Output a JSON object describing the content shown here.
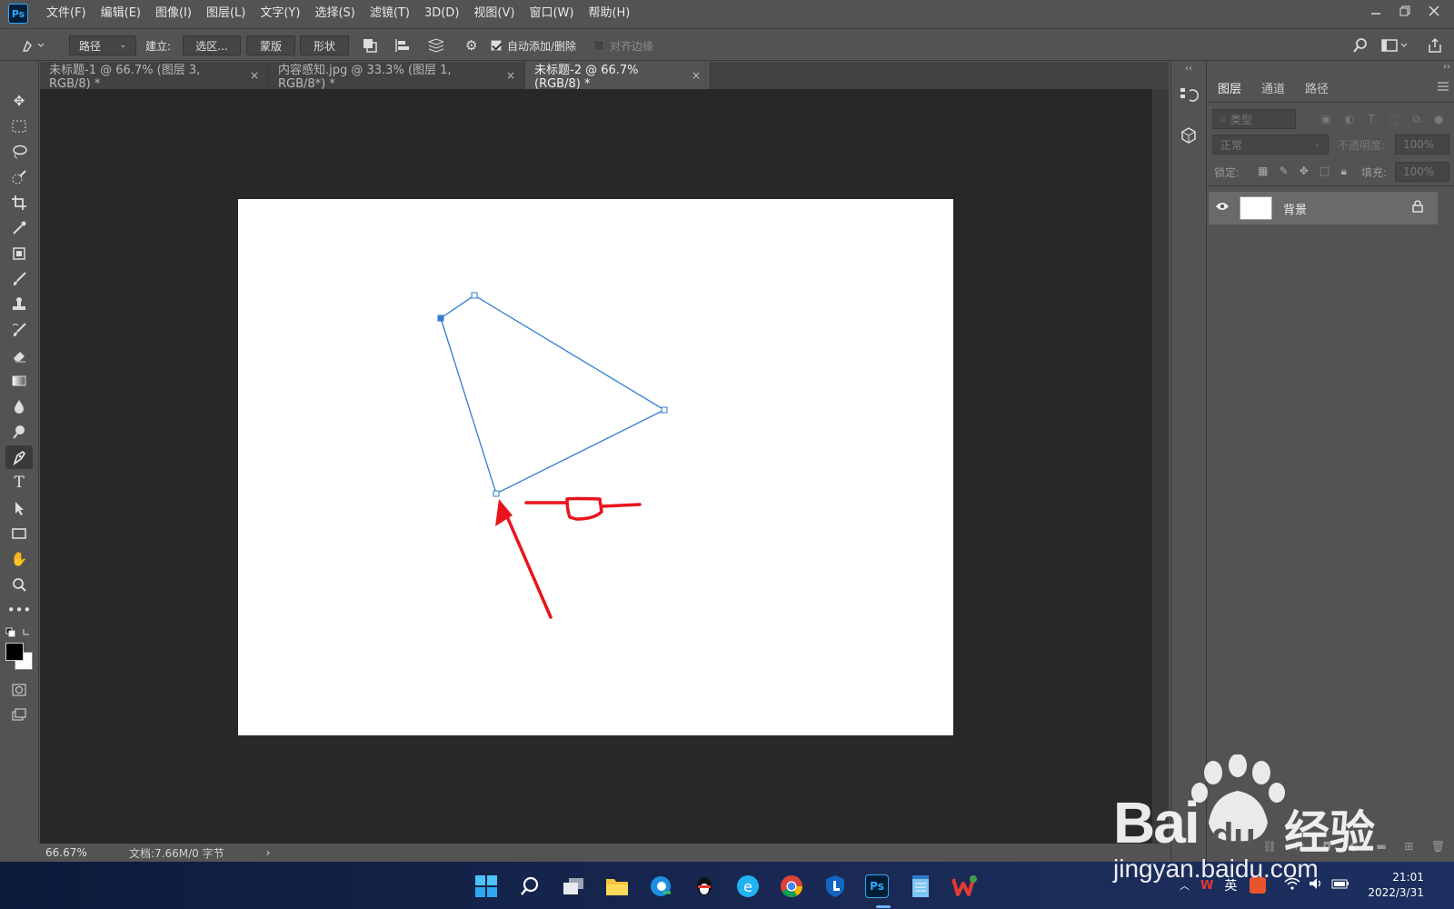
{
  "app": {
    "logo_text": "Ps",
    "menu": [
      "文件(F)",
      "编辑(E)",
      "图像(I)",
      "图层(L)",
      "文字(Y)",
      "选择(S)",
      "滤镜(T)",
      "3D(D)",
      "视图(V)",
      "窗口(W)",
      "帮助(H)"
    ]
  },
  "options": {
    "mode_select": "路径",
    "build_label": "建立:",
    "selection_btn": "选区...",
    "mask_btn": "蒙版",
    "shape_btn": "形状",
    "auto_add_label": "自动添加/删除",
    "auto_add_checked": true,
    "align_edges_label": "对齐边缘",
    "align_edges_checked": false
  },
  "tabs": [
    {
      "label": "未标题-1 @ 66.7% (图层 3, RGB/8) *",
      "active": false
    },
    {
      "label": "内容感知.jpg @ 33.3% (图层 1, RGB/8*) *",
      "active": false
    },
    {
      "label": "未标题-2 @ 66.7%(RGB/8) *",
      "active": true
    }
  ],
  "tab_close": "×",
  "status": {
    "zoom": "66.67%",
    "doc_info": "文档:7.66M/0 字节",
    "arrow": "›"
  },
  "layers_panel": {
    "tabs": [
      "图层",
      "通道",
      "路径"
    ],
    "filter_placeholder": "类型",
    "blend_mode": "正常",
    "opacity_label": "不透明度:",
    "opacity_value": "100%",
    "lock_label": "锁定:",
    "fill_label": "填充:",
    "fill_value": "100%",
    "layers": [
      {
        "name": "背景",
        "visible": true,
        "locked": true
      }
    ]
  },
  "taskbar": {
    "tray_lang": "英",
    "time": "21:01",
    "date": "2022/3/31"
  },
  "watermark": {
    "brand": "Bai",
    "brand2": "经验",
    "url": "jingyan.baidu.com"
  },
  "colors": {
    "path_stroke": "#2f7dd1",
    "annotation": "#e8141c",
    "ps_blue": "#31a8ff"
  }
}
